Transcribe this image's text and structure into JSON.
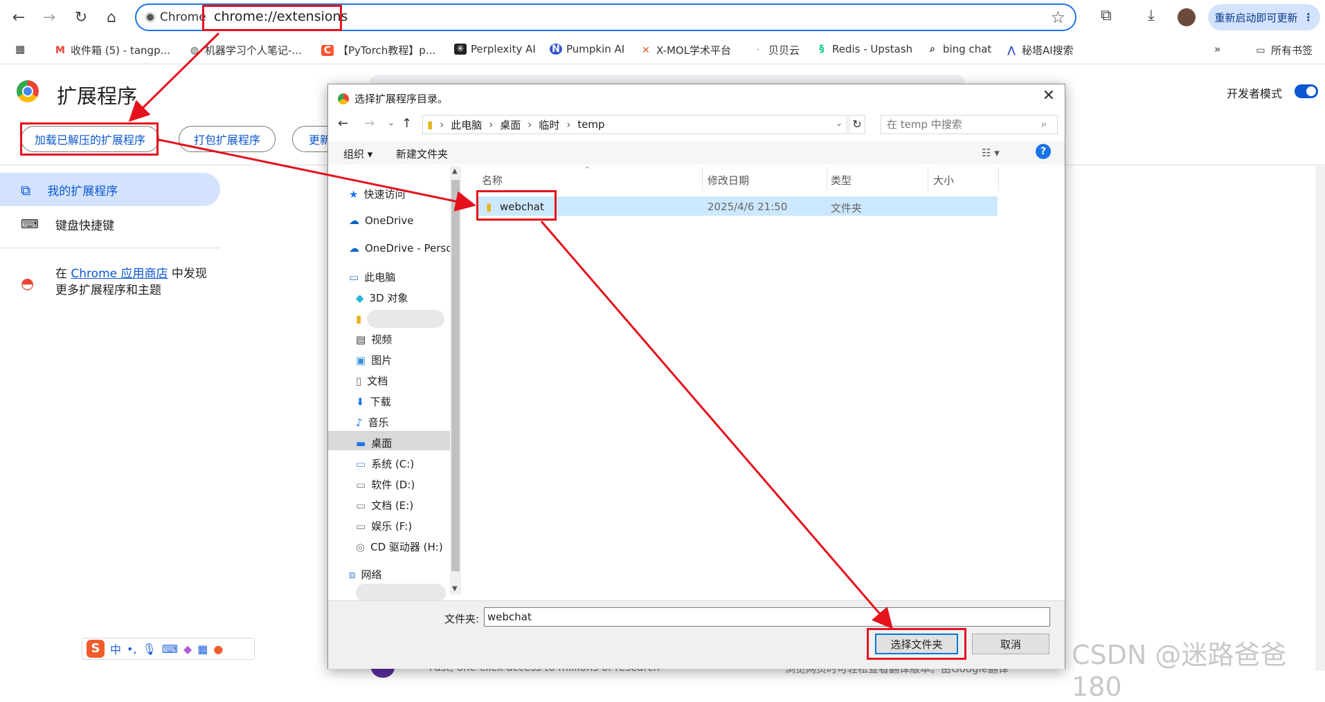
{
  "browser": {
    "chip_label": "Chrome",
    "url": "chrome://extensions",
    "update_button": "重新启动即可更新",
    "bookmarks": [
      {
        "icon": "gmail-icon",
        "label": "收件箱 (5) - tangp..."
      },
      {
        "icon": "globe-icon",
        "label": "机器学习个人笔记-..."
      },
      {
        "icon": "csdn-icon",
        "label": "【PyTorch教程】p..."
      },
      {
        "icon": "perplexity-icon",
        "label": "Perplexity AI"
      },
      {
        "icon": "pumpkin-icon",
        "label": "Pumpkin AI"
      },
      {
        "icon": "xmol-icon",
        "label": "X-MOL学术平台"
      },
      {
        "icon": "beibei-icon",
        "label": "贝贝云"
      },
      {
        "icon": "redis-icon",
        "label": "Redis - Upstash"
      },
      {
        "icon": "search-icon",
        "label": "bing chat"
      },
      {
        "icon": "metaso-icon",
        "label": "秘塔AI搜索"
      }
    ],
    "all_bookmarks": "所有书签",
    "more_bookmarks": "»"
  },
  "extensions_page": {
    "title": "扩展程序",
    "dev_mode_label": "开发者模式",
    "dev_mode_on": true,
    "buttons": {
      "load_unpacked": "加载已解压的扩展程序",
      "pack": "打包扩展程序",
      "update": "更新"
    },
    "sidebar": {
      "my_extensions": "我的扩展程序",
      "shortcuts": "键盘快捷键"
    },
    "store_prefix": "在",
    "store_link": "Chrome 应用商店",
    "store_suffix": "中发现",
    "store_line2": "更多扩展程序和主题",
    "ghost_text_left": "Fast, one-click access to millions of research",
    "ghost_text_right": "浏览网页时可轻松查看翻译版本。由Google翻译"
  },
  "dialog": {
    "title": "选择扩展程序目录。",
    "path": [
      "此电脑",
      "桌面",
      "临时",
      "temp"
    ],
    "search_placeholder": "在 temp 中搜索",
    "organize": "组织",
    "new_folder": "新建文件夹",
    "nav": {
      "quick_access": "快速访问",
      "onedrive": "OneDrive",
      "onedrive_personal": "OneDrive - Perso",
      "this_pc": "此电脑",
      "objects3d": "3D 对象",
      "video": "视频",
      "pictures": "图片",
      "documents": "文档",
      "downloads": "下载",
      "music": "音乐",
      "desktop": "桌面",
      "drive_c": "系统 (C:)",
      "drive_d": "软件 (D:)",
      "drive_e": "文档 (E:)",
      "drive_f": "娱乐 (F:)",
      "drive_h": "CD 驱动器 (H:)",
      "network": "网络"
    },
    "columns": {
      "name": "名称",
      "modified": "修改日期",
      "type": "类型",
      "size": "大小"
    },
    "files": [
      {
        "name": "webchat",
        "modified": "2025/4/6 21:50",
        "type": "文件夹",
        "size": ""
      }
    ],
    "folder_label": "文件夹:",
    "folder_value": "webchat",
    "select_button": "选择文件夹",
    "cancel_button": "取消"
  },
  "ime": {
    "mode": "中",
    "punct": "•,"
  },
  "watermark": "CSDN @迷路爸爸180"
}
